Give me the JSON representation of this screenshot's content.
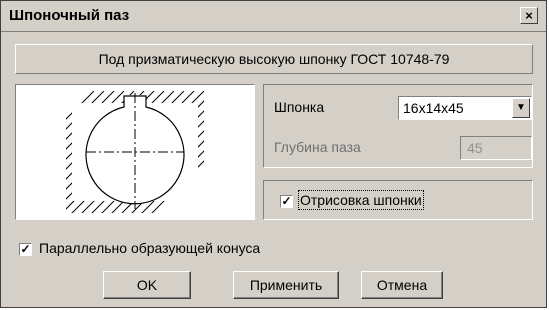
{
  "dialog": {
    "title": "Шпоночный паз",
    "close_label": "×",
    "header": "Под призматическую высокую шпонку ГОСТ 10748-79"
  },
  "params": {
    "key_label": "Шпонка",
    "key_value": "16x14x45",
    "depth_label": "Глубина паза",
    "depth_value": "45"
  },
  "options": {
    "draw_key_label": "Отрисовка шпонки",
    "draw_key_checked": true,
    "parallel_label": "Параллельно образующей конуса",
    "parallel_checked": true
  },
  "buttons": {
    "ok": "OK",
    "apply": "Применить",
    "cancel": "Отмена"
  },
  "icons": {
    "close": "close-icon",
    "dropdown": "chevron-down-icon",
    "check": "checkmark-icon"
  }
}
